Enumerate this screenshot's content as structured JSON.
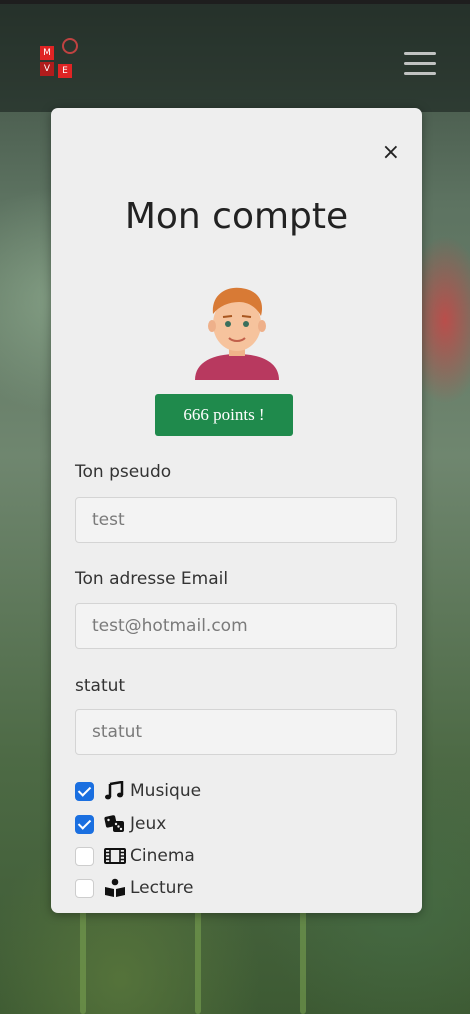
{
  "header": {
    "logo_letters": [
      "M",
      "V",
      "E"
    ],
    "menu_icon": "hamburger-icon"
  },
  "modal": {
    "close_label": "×",
    "title": "Mon compte",
    "avatar_icon": "user-avatar-icon",
    "points_badge": "666 points !"
  },
  "form": {
    "pseudo_label": "Ton pseudo",
    "pseudo_value": "test",
    "email_label": "Ton adresse Email",
    "email_value": "test@hotmail.com",
    "status_label": "statut",
    "status_placeholder": "statut"
  },
  "interests": [
    {
      "label": "Musique",
      "checked": true,
      "icon": "music-note-icon"
    },
    {
      "label": "Jeux",
      "checked": true,
      "icon": "dice-icon"
    },
    {
      "label": "Cinema",
      "checked": false,
      "icon": "film-icon"
    },
    {
      "label": "Lecture",
      "checked": false,
      "icon": "reading-icon"
    }
  ],
  "colors": {
    "badge": "#1f8a4c",
    "checkbox_checked": "#1a6fe0",
    "logo_red": "#e02424"
  }
}
